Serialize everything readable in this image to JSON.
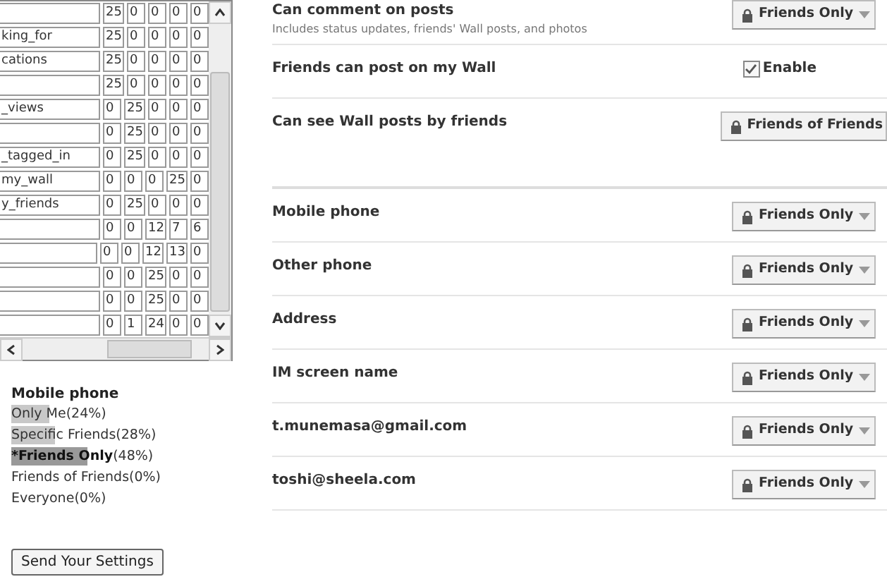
{
  "stats_table": {
    "rows": [
      {
        "name": "",
        "values": [
          "25",
          "0",
          "0",
          "0",
          "0"
        ]
      },
      {
        "name": "king_for",
        "values": [
          "25",
          "0",
          "0",
          "0",
          "0"
        ]
      },
      {
        "name": "cations",
        "values": [
          "25",
          "0",
          "0",
          "0",
          "0"
        ]
      },
      {
        "name": "",
        "values": [
          "25",
          "0",
          "0",
          "0",
          "0"
        ]
      },
      {
        "name": "_views",
        "values": [
          "0",
          "25",
          "0",
          "0",
          "0"
        ]
      },
      {
        "name": "",
        "values": [
          "0",
          "25",
          "0",
          "0",
          "0"
        ]
      },
      {
        "name": "_tagged_in",
        "values": [
          "0",
          "25",
          "0",
          "0",
          "0"
        ]
      },
      {
        "name": "my_wall",
        "values": [
          "0",
          "0",
          "0",
          "25",
          "0"
        ]
      },
      {
        "name": "y_friends",
        "values": [
          "0",
          "25",
          "0",
          "0",
          "0"
        ]
      },
      {
        "name": "",
        "values": [
          "0",
          "0",
          "12",
          "7",
          "6"
        ]
      },
      {
        "name": "",
        "values": [
          "0",
          "0",
          "12",
          "13",
          "0"
        ]
      },
      {
        "name": "",
        "values": [
          "0",
          "0",
          "25",
          "0",
          "0"
        ]
      },
      {
        "name": "",
        "values": [
          "0",
          "0",
          "25",
          "0",
          "0"
        ]
      },
      {
        "name": "",
        "values": [
          "0",
          "1",
          "24",
          "0",
          "0"
        ]
      }
    ]
  },
  "summary": {
    "title": "Mobile phone",
    "items": [
      {
        "label": "Only",
        "rest": " Me",
        "pct": "(24%)",
        "level": 0.24,
        "selected": false
      },
      {
        "label": "Specific",
        "rest": " Friends",
        "pct": "(28%)",
        "level": 0.28,
        "selected": false
      },
      {
        "label": "*Friends",
        "rest": " Only",
        "pct": "(48%)",
        "level": 0.48,
        "selected": true
      },
      {
        "label": "Friends",
        "rest": " of Friends",
        "pct": "(0%)",
        "selected": false
      },
      {
        "label": "Everyone",
        "pct": "(0%)",
        "selected": false
      }
    ]
  },
  "send_button": "Send Your Settings",
  "sections": [
    {
      "settings": [
        {
          "kind": "select",
          "label": "Can comment on posts",
          "note": "Includes status updates, friends' Wall posts, and photos",
          "value": "Friends Only",
          "caret": true
        },
        {
          "kind": "checkbox",
          "label": "Friends can post on my Wall",
          "value": "Enable",
          "checked": true
        },
        {
          "kind": "select",
          "label": "Can see Wall posts by friends",
          "value": "Friends of Friends",
          "caret": false
        }
      ]
    },
    {
      "settings": [
        {
          "kind": "select",
          "label": "Mobile phone",
          "value": "Friends Only",
          "caret": true
        },
        {
          "kind": "select",
          "label": "Other phone",
          "value": "Friends Only",
          "caret": true
        },
        {
          "kind": "select",
          "label": "Address",
          "value": "Friends Only",
          "caret": true
        },
        {
          "kind": "select",
          "label": "IM screen name",
          "value": "Friends Only",
          "caret": true
        },
        {
          "kind": "select",
          "label": "t.munemasa@gmail.com",
          "value": "Friends Only",
          "caret": true
        },
        {
          "kind": "select",
          "label": "toshi@sheela.com",
          "value": "Friends Only",
          "caret": true
        }
      ]
    }
  ]
}
